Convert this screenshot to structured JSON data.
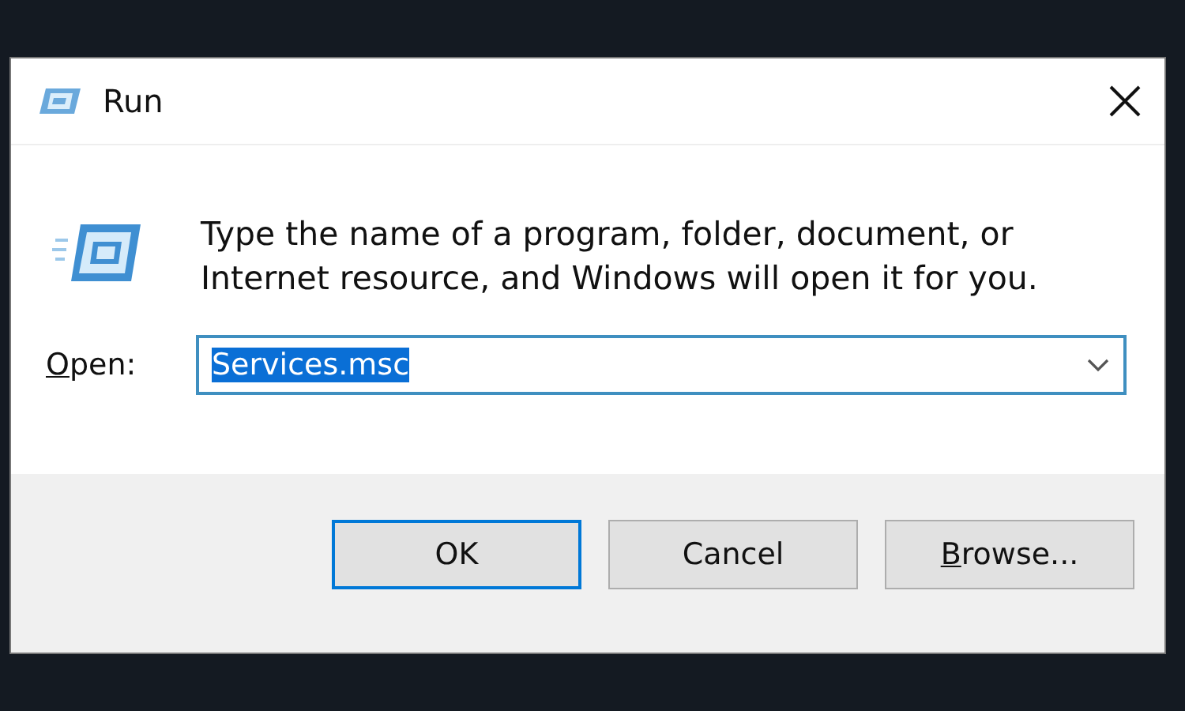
{
  "window": {
    "title": "Run"
  },
  "prompt": "Type the name of a program, folder, document, or Internet resource, and Windows will open it for you.",
  "open_field": {
    "label": "Open:",
    "label_mnemonic": true,
    "value": "Services.msc",
    "value_selected": true
  },
  "buttons": [
    {
      "label": "OK",
      "default": true,
      "mnemonic": false
    },
    {
      "label": "Cancel",
      "default": false,
      "mnemonic": false
    },
    {
      "label": "Browse...",
      "default": false,
      "mnemonic": true
    }
  ]
}
